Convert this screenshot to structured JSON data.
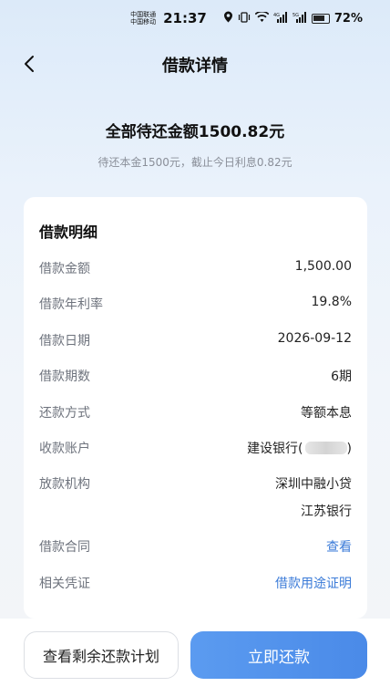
{
  "status_bar": {
    "carrier1": "中国联通",
    "carrier2": "中国移动",
    "time": "21:37",
    "signal1": "⁴ᴳ",
    "signal2": "⁵ᴳ",
    "battery": "72%"
  },
  "nav": {
    "title": "借款详情"
  },
  "summary": {
    "total": "全部待还金额1500.82元",
    "sub": "待还本金1500元，截止今日利息0.82元"
  },
  "detail": {
    "title": "借款明细",
    "rows": [
      {
        "label": "借款金额",
        "value": "1,500.00"
      },
      {
        "label": "借款年利率",
        "value": "19.8%"
      },
      {
        "label": "借款日期",
        "value": "2026-09-12"
      },
      {
        "label": "借款期数",
        "value": "6期"
      },
      {
        "label": "还款方式",
        "value": "等额本息"
      },
      {
        "label": "收款账户",
        "value": "建设银行(",
        "value_suffix": ")"
      },
      {
        "label": "放款机构",
        "value": "深圳中融小贷",
        "value2": "江苏银行"
      },
      {
        "label": "借款合同",
        "value": "查看"
      },
      {
        "label": "相关凭证",
        "value": "借款用途证明"
      }
    ]
  },
  "actions": {
    "plan_label": "查看剩余还款计划",
    "repay_label": "立即还款"
  },
  "colors": {
    "primary": "#4a8ae8",
    "link": "#3b7bd8",
    "label_gray": "#6e737d"
  }
}
